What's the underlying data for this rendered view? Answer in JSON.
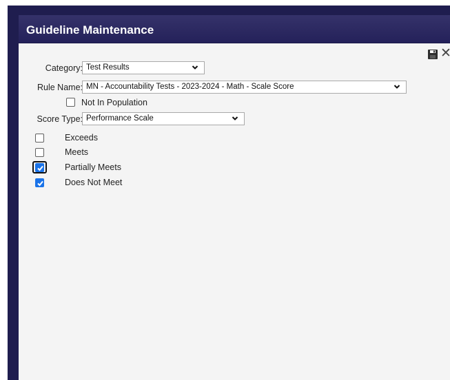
{
  "dialog": {
    "title": "Guideline Maintenance"
  },
  "toolbar": {
    "save_icon": "save-icon",
    "close_glyph": "✕"
  },
  "form": {
    "category": {
      "label": "Category:",
      "value": "Test Results"
    },
    "rule_name": {
      "label": "Rule Name:",
      "value": "MN - Accountability Tests - 2023-2024 - Math - Scale Score"
    },
    "not_in_population": {
      "label": "Not In Population",
      "checked": false
    },
    "score_type": {
      "label": "Score Type:",
      "value": "Performance Scale"
    },
    "levels": [
      {
        "label": "Exceeds",
        "checked": false
      },
      {
        "label": "Meets",
        "checked": false
      },
      {
        "label": "Partially Meets",
        "checked": true
      },
      {
        "label": "Does Not Meet",
        "checked": true
      }
    ]
  },
  "colors": {
    "title_bar": "#2b2860",
    "checkbox_checked": "#1a73e8",
    "panel_bg": "#f4f4f4"
  }
}
